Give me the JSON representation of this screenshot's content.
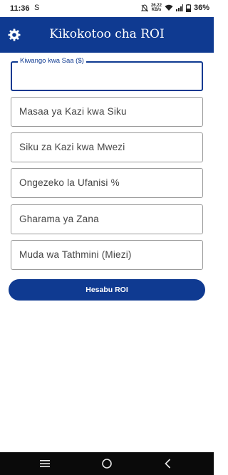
{
  "status_bar": {
    "time": "11:36",
    "sim_icon": "S",
    "speed_value": "26.22",
    "speed_unit": "KB/s",
    "battery": "36%"
  },
  "app_bar": {
    "title": "Kikokotoo cha ROI",
    "settings_icon": "gear-icon"
  },
  "form": {
    "hourly_rate": {
      "label": "Kiwango kwa Saa ($)",
      "value": ""
    },
    "hours_per_day": {
      "placeholder": "Masaa ya Kazi kwa Siku"
    },
    "days_per_month": {
      "placeholder": "Siku za Kazi kwa Mwezi"
    },
    "efficiency_gain": {
      "placeholder": "Ongezeko la Ufanisi %"
    },
    "tool_cost": {
      "placeholder": "Gharama ya Zana"
    },
    "evaluation_period": {
      "placeholder": "Muda wa Tathmini (Miezi)"
    }
  },
  "calculate_button": {
    "label": "Hesabu ROI"
  },
  "colors": {
    "primary": "#0f3a91",
    "border": "#9a9a9a",
    "nav_bar": "#0a0a0a"
  }
}
